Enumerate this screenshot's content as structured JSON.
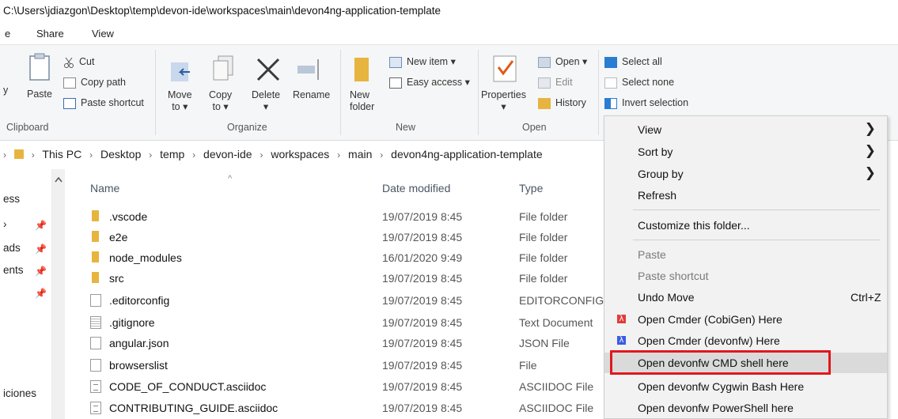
{
  "window": {
    "title_path": "C:\\Users\\jdiazgon\\Desktop\\temp\\devon-ide\\workspaces\\main\\devon4ng-application-template"
  },
  "menu_tabs": [
    {
      "label": "e"
    },
    {
      "label": "Share"
    },
    {
      "label": "View"
    }
  ],
  "ribbon": {
    "clipboard": {
      "cut": "Cut",
      "copy_path": "Copy path",
      "paste": "Paste",
      "paste_shortcut": "Paste shortcut",
      "partial_label": "y",
      "group_label": "Clipboard"
    },
    "organize": {
      "move_to": "Move",
      "move_to2": "to ▾",
      "copy_to": "Copy",
      "copy_to2": "to ▾",
      "delete": "Delete",
      "delete2": "▾",
      "rename": "Rename",
      "group_label": "Organize"
    },
    "new": {
      "new_folder": "New",
      "new_folder2": "folder",
      "new_item": "New item ▾",
      "easy_access": "Easy access ▾",
      "group_label": "New"
    },
    "open": {
      "properties": "Properties",
      "properties2": "▾",
      "open": "Open ▾",
      "edit": "Edit",
      "history": "History",
      "group_label": "Open"
    },
    "select": {
      "select_all": "Select all",
      "select_none": "Select none",
      "invert_selection": "Invert selection"
    }
  },
  "breadcrumb": {
    "items": [
      "This PC",
      "Desktop",
      "temp",
      "devon-ide",
      "workspaces",
      "main",
      "devon4ng-application-template"
    ],
    "separator": "›"
  },
  "nav_pane": {
    "items": [
      {
        "label": "ess"
      },
      {
        "label": "›"
      },
      {
        "label": "ads"
      },
      {
        "label": "ents"
      },
      {
        "label": "iciones"
      }
    ],
    "pin_glyph": "📌"
  },
  "file_list": {
    "columns": {
      "name": "Name",
      "date_modified": "Date modified",
      "type": "Type"
    },
    "sort_indicator": "^",
    "rows": [
      {
        "name": ".vscode",
        "date": "19/07/2019 8:45",
        "type": "File folder",
        "icon": "folder-icon"
      },
      {
        "name": "e2e",
        "date": "19/07/2019 8:45",
        "type": "File folder",
        "icon": "folder-icon"
      },
      {
        "name": "node_modules",
        "date": "16/01/2020 9:49",
        "type": "File folder",
        "icon": "folder-icon"
      },
      {
        "name": "src",
        "date": "19/07/2019 8:45",
        "type": "File folder",
        "icon": "folder-icon"
      },
      {
        "name": ".editorconfig",
        "date": "19/07/2019 8:45",
        "type": "EDITORCONFIG",
        "icon": "file-icon"
      },
      {
        "name": ".gitignore",
        "date": "19/07/2019 8:45",
        "type": "Text Document",
        "icon": "text-file-icon"
      },
      {
        "name": "angular.json",
        "date": "19/07/2019 8:45",
        "type": "JSON File",
        "icon": "file-icon"
      },
      {
        "name": "browserslist",
        "date": "19/07/2019 8:45",
        "type": "File",
        "icon": "file-icon"
      },
      {
        "name": "CODE_OF_CONDUCT.asciidoc",
        "date": "19/07/2019 8:45",
        "type": "ASCIIDOC File",
        "icon": "asciidoc-file-icon"
      },
      {
        "name": "CONTRIBUTING_GUIDE.asciidoc",
        "date": "19/07/2019 8:45",
        "type": "ASCIIDOC File",
        "icon": "asciidoc-file-icon"
      }
    ]
  },
  "context_menu": {
    "items": [
      {
        "label": "View",
        "submenu": true
      },
      {
        "label": "Sort by",
        "submenu": true
      },
      {
        "label": "Group by",
        "submenu": true
      },
      {
        "label": "Refresh"
      },
      {
        "label": "Customize this folder..."
      },
      {
        "label": "Paste",
        "disabled": true
      },
      {
        "label": "Paste shortcut",
        "disabled": true
      },
      {
        "label": "Undo Move",
        "shortcut": "Ctrl+Z"
      },
      {
        "label": "Open Cmder (CobiGen) Here",
        "icon": "cmder-lambda-icon",
        "icon_color": "#e03c3c"
      },
      {
        "label": "Open Cmder (devonfw) Here",
        "icon": "cmder-lambda-icon",
        "icon_color": "#3c5ce0"
      },
      {
        "label": "Open devonfw CMD shell here",
        "highlighted": true
      },
      {
        "label": "Open devonfw Cygwin Bash Here"
      },
      {
        "label": "Open devonfw PowerShell here"
      }
    ],
    "submenu_arrow": "❯",
    "lambda_glyph": "λ"
  },
  "colors": {
    "highlight_box": "#e0181e",
    "folder": "#e8b440",
    "select_blue": "#2b7cd3"
  }
}
